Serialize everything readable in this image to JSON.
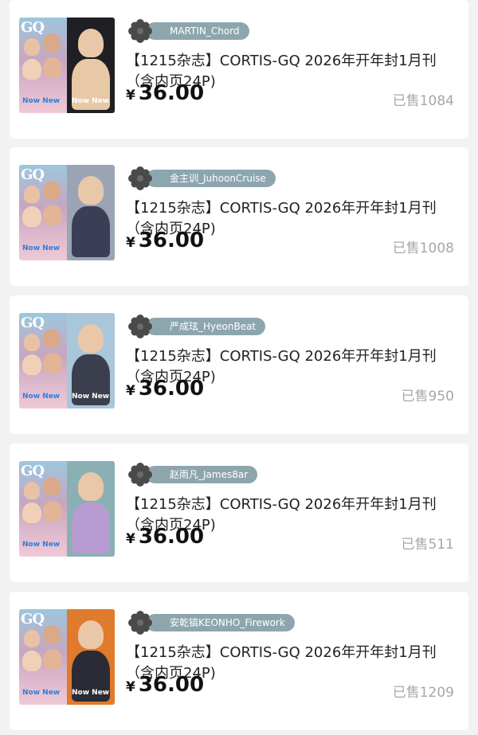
{
  "products": [
    {
      "seller": "MARTIN_Chord",
      "title": "【1215杂志】CORTIS-GQ 2026年开年封1月刊（含内页24P)",
      "currency": "¥",
      "price": "36.00",
      "sold": "已售1084",
      "cover_text_left": "Now New",
      "cover_text_right": "Now New",
      "cover_colors": {
        "right_bg": "#1f1f24",
        "right_figure": "#e7c9a5"
      }
    },
    {
      "seller": "金主训_JuhoonCruise",
      "title": "【1215杂志】CORTIS-GQ 2026年开年封1月刊（含内页24P)",
      "currency": "¥",
      "price": "36.00",
      "sold": "已售1008",
      "cover_text_left": "Now New",
      "cover_text_right": "",
      "cover_colors": {
        "right_bg": "#9aa4b5",
        "right_figure": "#3a3f57"
      }
    },
    {
      "seller": "严成玹_HyeonBeat",
      "title": "【1215杂志】CORTIS-GQ 2026年开年封1月刊（含内页24P)",
      "currency": "¥",
      "price": "36.00",
      "sold": "已售950",
      "cover_text_left": "Now New",
      "cover_text_right": "Now New",
      "cover_colors": {
        "right_bg": "#a9c6da",
        "right_figure": "#3b3f4d"
      }
    },
    {
      "seller": "赵雨凡_James8ar",
      "title": "【1215杂志】CORTIS-GQ 2026年开年封1月刊（含内页24P)",
      "currency": "¥",
      "price": "36.00",
      "sold": "已售511",
      "cover_text_left": "Now New",
      "cover_text_right": "",
      "cover_colors": {
        "right_bg": "#8ab0b4",
        "right_figure": "#b79bd1"
      }
    },
    {
      "seller": "安乾镐KEONHO_Firework",
      "title": "【1215杂志】CORTIS-GQ 2026年开年封1月刊（含内页24P)",
      "currency": "¥",
      "price": "36.00",
      "sold": "已售1209",
      "cover_text_left": "Now New",
      "cover_text_right": "Now New",
      "cover_colors": {
        "right_bg": "#e07a2c",
        "right_figure": "#2b2b35"
      }
    }
  ],
  "colors": {
    "background": "#f2f2f4",
    "seller_pill": "#8da6ad",
    "sold_text": "#a7a7a7",
    "price_text": "#111111"
  },
  "icons": {
    "seller_avatar": "flower-badge-icon"
  }
}
